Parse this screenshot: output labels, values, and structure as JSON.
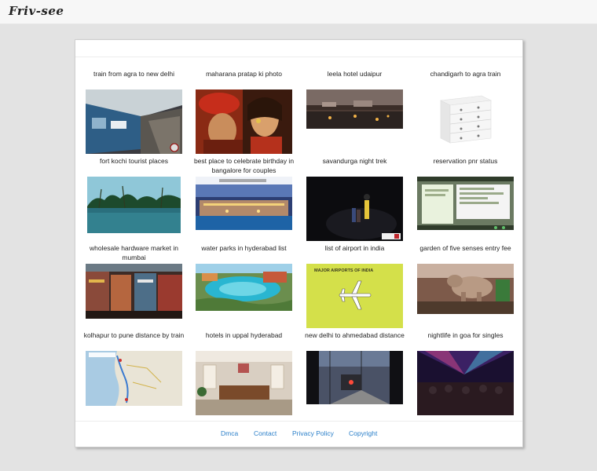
{
  "site": {
    "logo": "Friv-see"
  },
  "items": [
    {
      "caption": "train from agra to new delhi"
    },
    {
      "caption": "maharana pratap ki photo"
    },
    {
      "caption": "leela hotel udaipur"
    },
    {
      "caption": "chandigarh to agra train"
    },
    {
      "caption": "fort kochi tourist places"
    },
    {
      "caption": "best place to celebrate birthday in bangalore for couples"
    },
    {
      "caption": "savandurga night trek"
    },
    {
      "caption": "reservation pnr status"
    },
    {
      "caption": "wholesale hardware market in mumbai"
    },
    {
      "caption": "water parks in hyderabad list"
    },
    {
      "caption": "list of airport in india"
    },
    {
      "caption": "garden of five senses entry fee"
    },
    {
      "caption": "kolhapur to pune distance by train"
    },
    {
      "caption": "hotels in uppal hyderabad"
    },
    {
      "caption": "new delhi to ahmedabad distance"
    },
    {
      "caption": "nightlife in goa for singles"
    }
  ],
  "thumb_text": {
    "airport_banner": "MAJOR AIRPORTS OF INDIA"
  },
  "footer": {
    "links": [
      "Dmca",
      "Contact",
      "Privacy Policy",
      "Copyright"
    ]
  }
}
